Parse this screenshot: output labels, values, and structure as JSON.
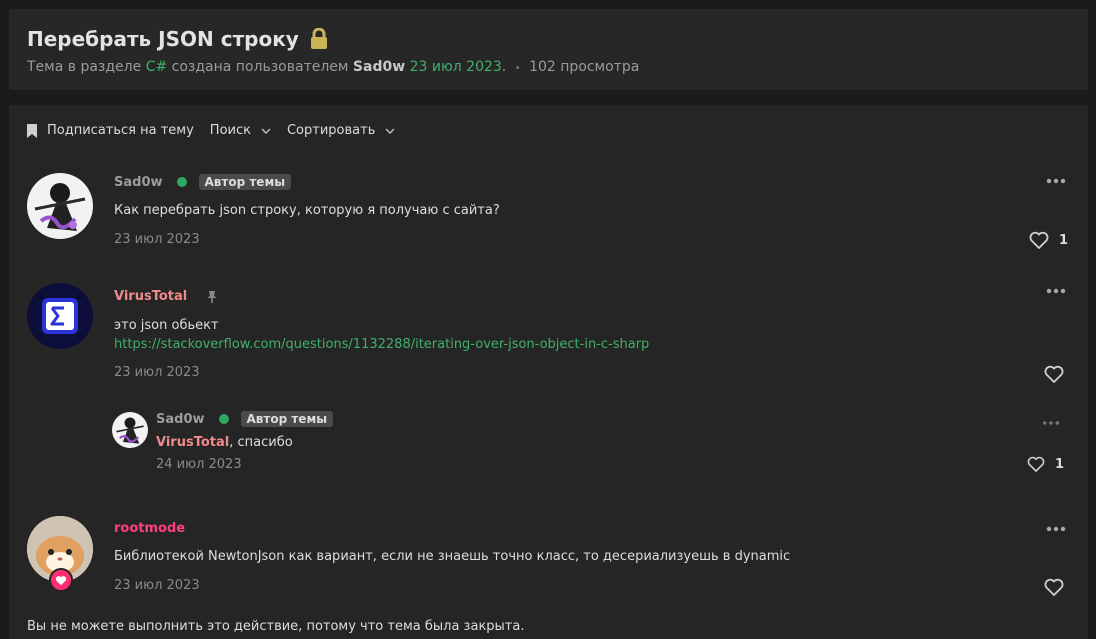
{
  "header": {
    "title": "Перебрать JSON строку",
    "meta_prefix": "Тема в разделе",
    "section": "C#",
    "meta_mid": "создана пользователем",
    "author": "Sad0w",
    "date": "23 июл 2023",
    "meta_dot": ".",
    "views": "102 просмотра"
  },
  "toolbar": {
    "subscribe": "Подписаться на тему",
    "search": "Поиск",
    "sort": "Сортировать"
  },
  "posts": [
    {
      "author": "Sad0w",
      "badge": "Автор темы",
      "text": "Как перебрать json строку, которую я получаю с сайта?",
      "date": "23 июл 2023",
      "likes": "1"
    },
    {
      "author": "VirusTotal",
      "text": "это json обьект",
      "link": "https://stackoverflow.com/questions/1132288/iterating-over-json-object-in-c-sharp",
      "date": "23 июл 2023"
    },
    {
      "author": "Sad0w",
      "badge": "Автор темы",
      "mention": "VirusTotal",
      "text": ", спасибо",
      "date": "24 июл 2023",
      "likes": "1"
    },
    {
      "author": "rootmode",
      "text": "Библиотекой NewtonJson как вариант, если не знаешь точно класс, то десериализуешь в dynamic",
      "date": "23 июл 2023"
    }
  ],
  "footer": {
    "closed_note": "Вы не можете выполнить это действие, потому что тема была закрыта."
  },
  "colors": {
    "accent_green": "#3fb06b",
    "virustotal_name": "#f08a8a",
    "rootmode_name": "#ff3f7f",
    "online": "#2ea862"
  }
}
